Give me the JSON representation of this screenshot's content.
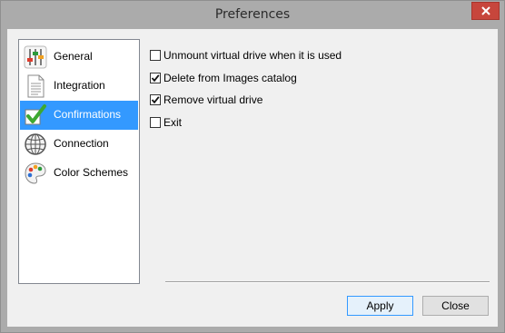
{
  "window": {
    "title": "Preferences"
  },
  "sidebar": {
    "items": [
      {
        "label": "General",
        "icon": "sliders-icon",
        "selected": false
      },
      {
        "label": "Integration",
        "icon": "document-icon",
        "selected": false
      },
      {
        "label": "Confirmations",
        "icon": "checkmark-icon",
        "selected": true
      },
      {
        "label": "Connection",
        "icon": "globe-icon",
        "selected": false
      },
      {
        "label": "Color Schemes",
        "icon": "palette-icon",
        "selected": false
      }
    ]
  },
  "options": [
    {
      "label": "Unmount virtual drive when it is used",
      "checked": false
    },
    {
      "label": "Delete from Images catalog",
      "checked": true
    },
    {
      "label": "Remove virtual drive",
      "checked": true
    },
    {
      "label": "Exit",
      "checked": false
    }
  ],
  "buttons": {
    "apply": "Apply",
    "close": "Close"
  },
  "colors": {
    "selection": "#3399ff",
    "title_close": "#c7463c",
    "chrome": "#ababab"
  }
}
